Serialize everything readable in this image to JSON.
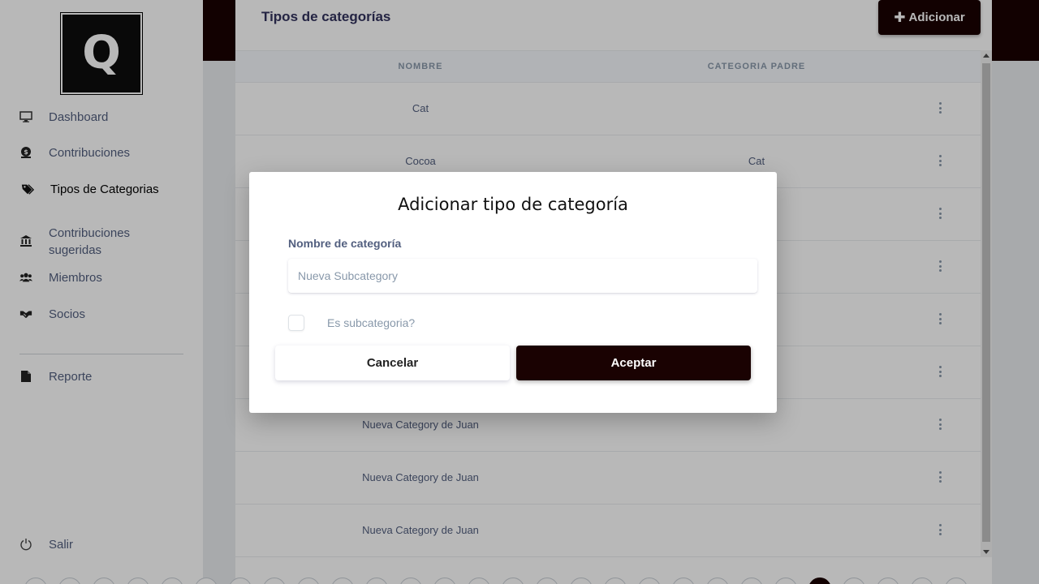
{
  "logo": {
    "letter": "Q"
  },
  "sidebar": {
    "items": [
      {
        "label": "Dashboard",
        "icon": "monitor-icon"
      },
      {
        "label": "Contribuciones",
        "icon": "money-bag-icon"
      },
      {
        "label": "Tipos de Categorias",
        "icon": "tags-icon",
        "active": true
      },
      {
        "label": "Contribuciones sugeridas",
        "icon": "bank-icon"
      },
      {
        "label": "Miembros",
        "icon": "users-icon"
      },
      {
        "label": "Socios",
        "icon": "handshake-icon"
      },
      {
        "label": "Reporte",
        "icon": "file-icon"
      }
    ],
    "logout": {
      "label": "Salir",
      "icon": "power-icon"
    }
  },
  "page": {
    "title": "Tipos de categorías",
    "add_button": "Adicionar"
  },
  "table": {
    "columns": [
      "NOMBRE",
      "CATEGORIA PADRE"
    ],
    "rows": [
      {
        "nombre": "Cat",
        "padre": ""
      },
      {
        "nombre": "Cocoa",
        "padre": "Cat"
      },
      {
        "nombre": "",
        "padre": ""
      },
      {
        "nombre": "",
        "padre": ""
      },
      {
        "nombre": "",
        "padre": ""
      },
      {
        "nombre": "",
        "padre": ""
      },
      {
        "nombre": "Nueva Category de Juan",
        "padre": ""
      },
      {
        "nombre": "Nueva Category de Juan",
        "padre": ""
      },
      {
        "nombre": "Nueva Category de Juan",
        "padre": ""
      }
    ]
  },
  "modal": {
    "title": "Adicionar tipo de categoría",
    "field_label": "Nombre de categoría",
    "field_placeholder": "Nueva Subcategory",
    "field_value": "",
    "checkbox_label": "Es subcategoria?",
    "checkbox_checked": false,
    "cancel_label": "Cancelar",
    "accept_label": "Aceptar"
  },
  "colors": {
    "brand": "#1a0202",
    "text": "#525f7f",
    "muted": "#8898aa"
  }
}
